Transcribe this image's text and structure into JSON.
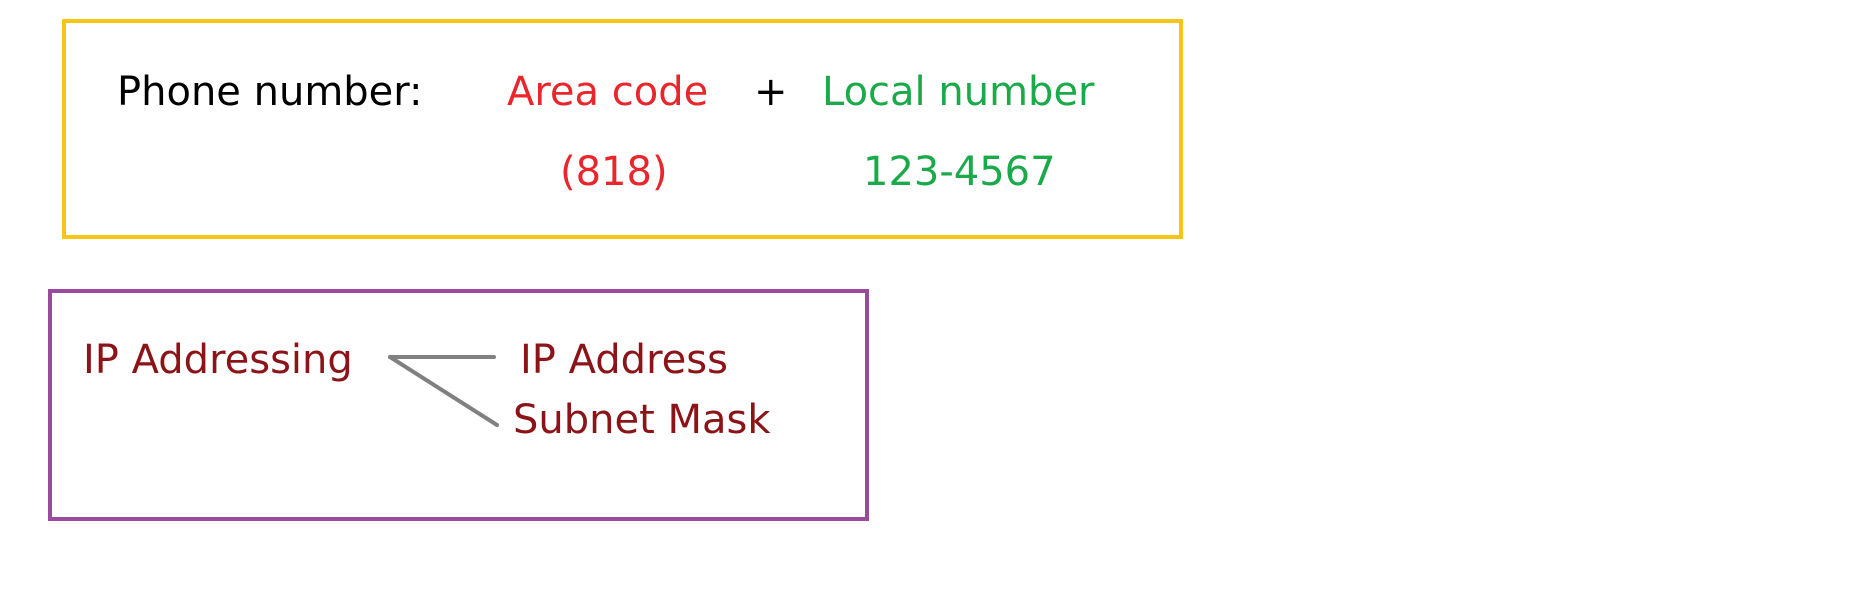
{
  "phone": {
    "label": "Phone number:",
    "area_code_label": "Area code",
    "plus": "+",
    "local_number_label": "Local number",
    "area_code_value": "(818)",
    "local_number_value": "123-4567"
  },
  "ip": {
    "root": "IP Addressing",
    "branch_1": "IP Address",
    "branch_2": "Subnet Mask"
  },
  "colors": {
    "phone_box_border": "#f5c518",
    "ip_box_border": "#9c4a9e",
    "area_code": "#e8262b",
    "local_number": "#1aaa4a",
    "ip_text": "#8b1418",
    "connector": "#808080"
  }
}
